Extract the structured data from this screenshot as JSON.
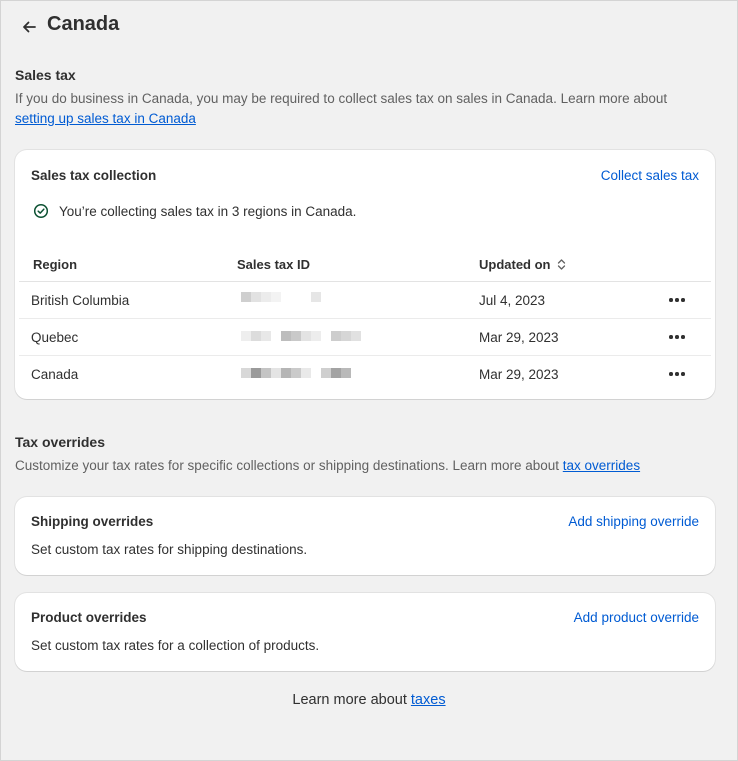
{
  "header": {
    "title": "Canada"
  },
  "sales_tax": {
    "title": "Sales tax",
    "description": "If you do business in Canada, you may be required to collect sales tax on sales in Canada. Learn more about ",
    "link": "setting up sales tax in Canada"
  },
  "collection_card": {
    "title": "Sales tax collection",
    "action": "Collect sales tax",
    "status": "You’re collecting sales tax in 3 regions in Canada.",
    "columns": {
      "region": "Region",
      "tax_id": "Sales tax ID",
      "updated": "Updated on"
    },
    "rows": [
      {
        "region": "British Columbia",
        "updated": "Jul 4, 2023"
      },
      {
        "region": "Quebec",
        "updated": "Mar 29, 2023"
      },
      {
        "region": "Canada",
        "updated": "Mar 29, 2023"
      }
    ]
  },
  "overrides": {
    "title": "Tax overrides",
    "description": "Customize your tax rates for specific collections or shipping destinations. Learn more about ",
    "link": "tax overrides"
  },
  "shipping_card": {
    "title": "Shipping overrides",
    "action": "Add shipping override",
    "text": "Set custom tax rates for shipping destinations."
  },
  "product_card": {
    "title": "Product overrides",
    "action": "Add product override",
    "text": "Set custom tax rates for a collection of products."
  },
  "footer": {
    "text": "Learn more about ",
    "link": "taxes"
  },
  "colors": {
    "accent": "#005bd3",
    "success": "#0c5132",
    "background": "#f1f1f1"
  }
}
